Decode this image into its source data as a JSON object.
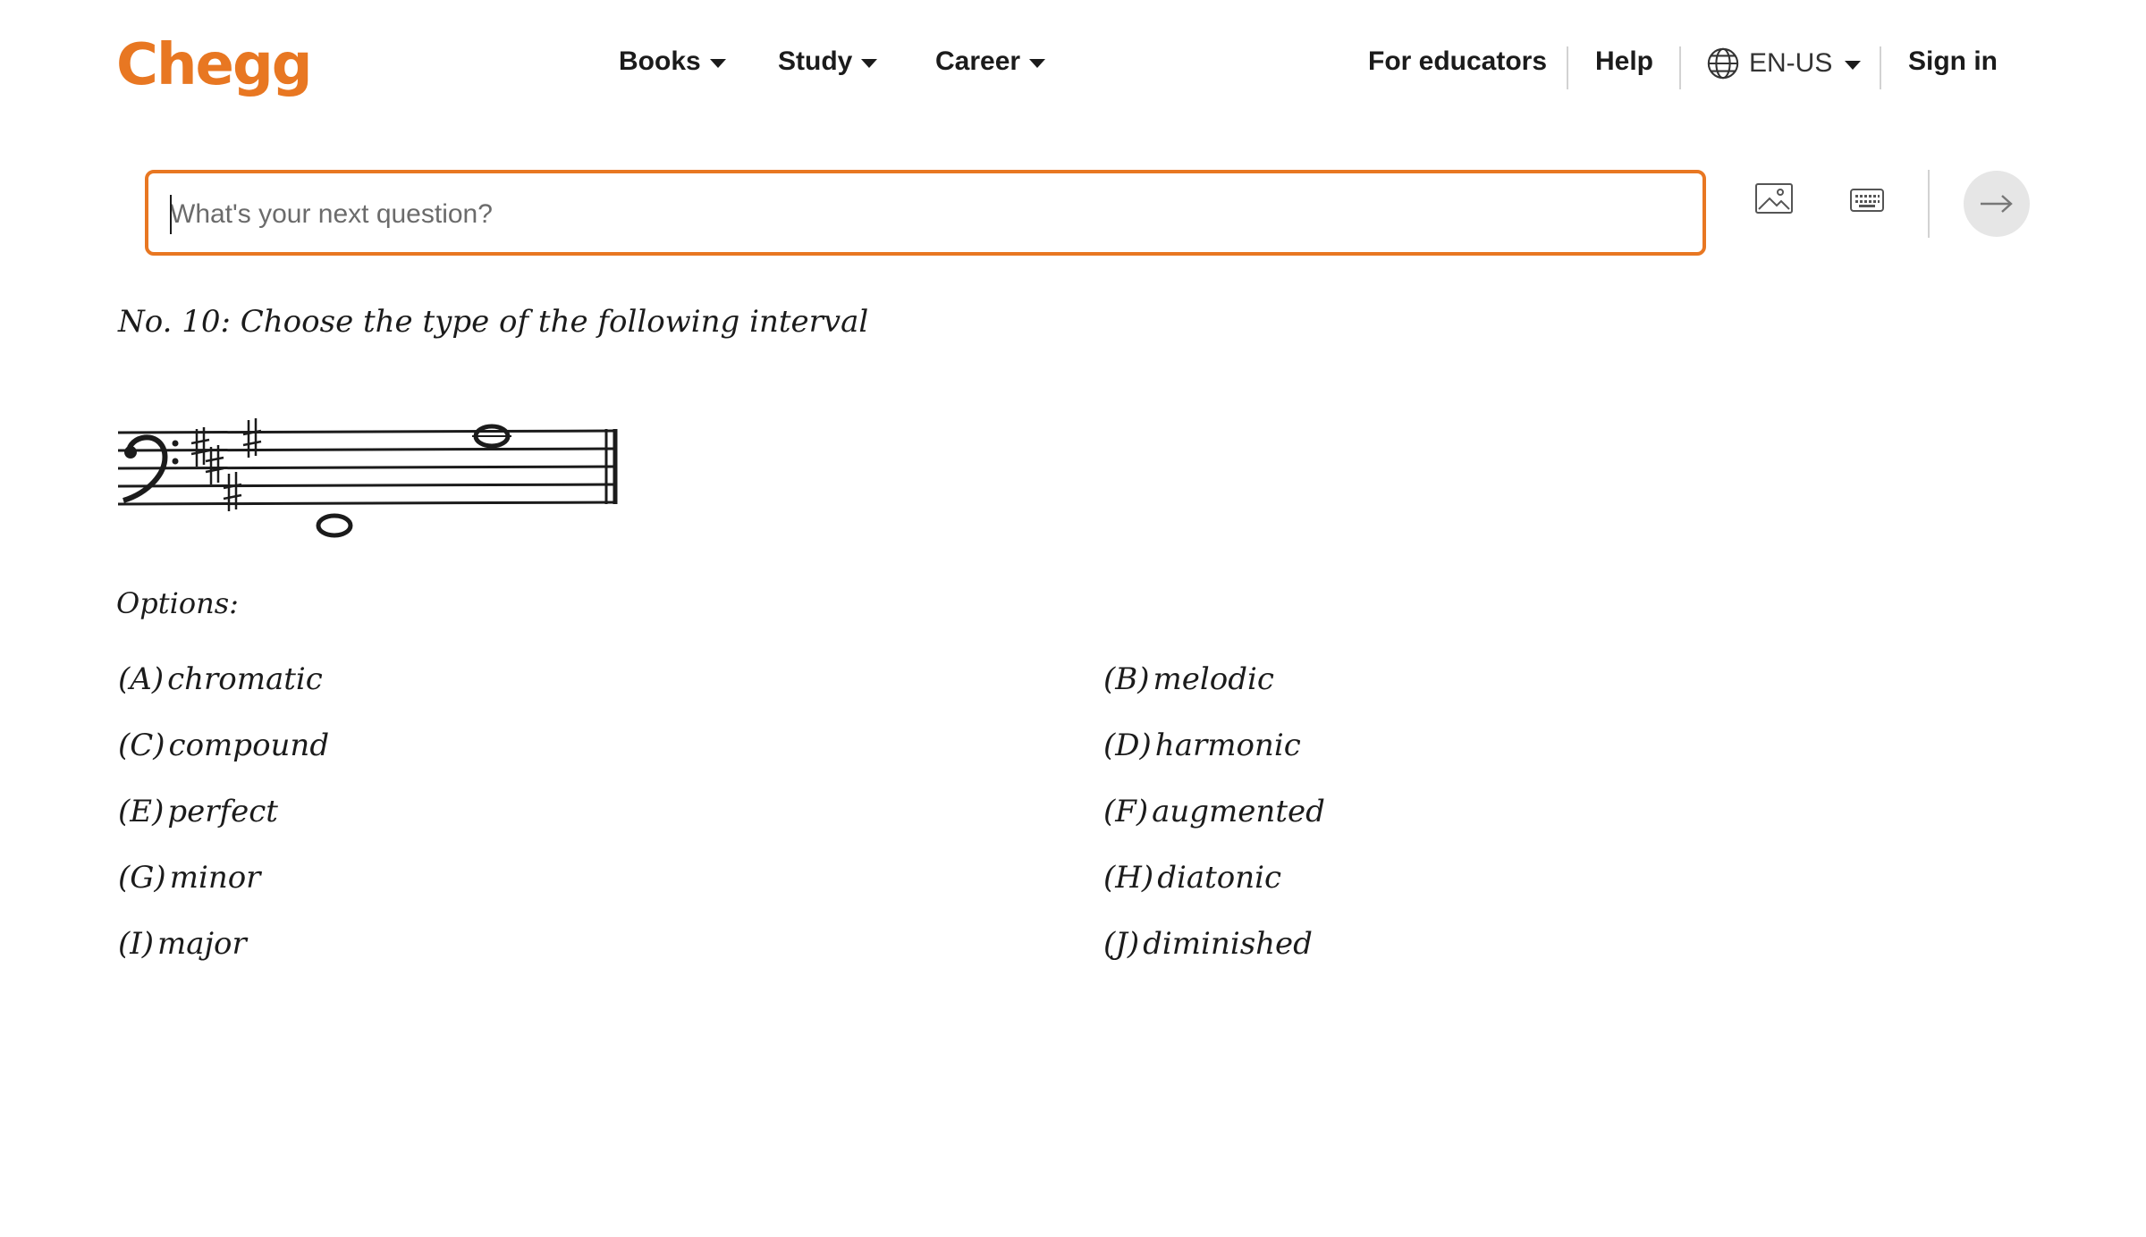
{
  "header": {
    "logo": "Chegg",
    "nav": [
      {
        "label": "Books"
      },
      {
        "label": "Study"
      },
      {
        "label": "Career"
      }
    ],
    "for_educators": "For educators",
    "help": "Help",
    "language": "EN-US",
    "sign_in": "Sign in"
  },
  "search": {
    "placeholder": "What's your next question?",
    "value": ""
  },
  "question": {
    "title": "No. 10: Choose the type of the following interval",
    "options_label": "Options:",
    "options": [
      {
        "letter": "(A)",
        "text": "chromatic"
      },
      {
        "letter": "(B)",
        "text": "melodic"
      },
      {
        "letter": "(C)",
        "text": "compound"
      },
      {
        "letter": "(D)",
        "text": "harmonic"
      },
      {
        "letter": "(E)",
        "text": "perfect"
      },
      {
        "letter": "(F)",
        "text": "augmented"
      },
      {
        "letter": "(G)",
        "text": "minor"
      },
      {
        "letter": "(H)",
        "text": "diatonic"
      },
      {
        "letter": "(I)",
        "text": "major"
      },
      {
        "letter": "(J)",
        "text": "diminished"
      }
    ]
  },
  "colors": {
    "brand": "#e87722",
    "text": "#1b1b1b",
    "submit_bg": "#e6e6e6"
  },
  "icons": {
    "image_upload": "image-icon",
    "keyboard": "keyboard-icon",
    "submit": "arrow-right-icon",
    "language": "globe-icon"
  }
}
